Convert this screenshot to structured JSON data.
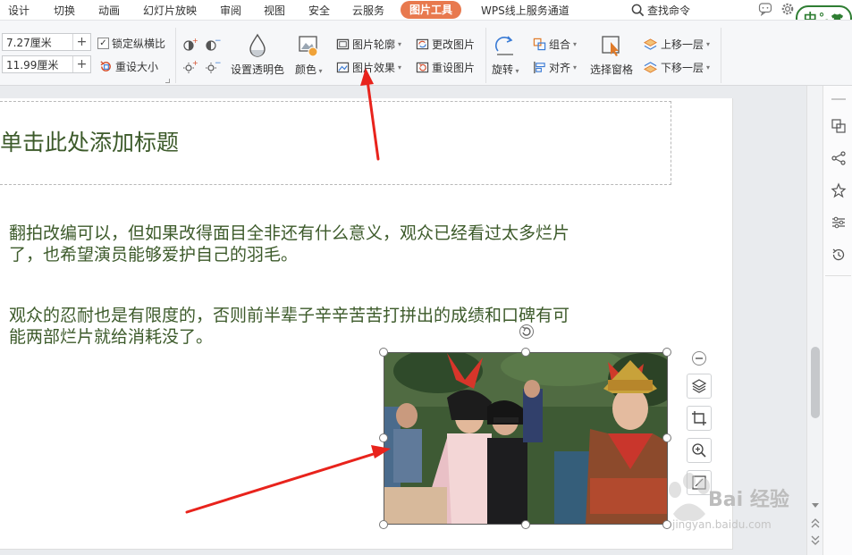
{
  "menu": {
    "tabs": [
      "设计",
      "切换",
      "动画",
      "幻灯片放映",
      "审阅",
      "视图",
      "安全",
      "云服务",
      "图片工具",
      "WPS线上服务通道"
    ],
    "active_tab": "图片工具",
    "search_label": "查找命令"
  },
  "ime": {
    "label": "中",
    "symbols": "°,"
  },
  "ribbon": {
    "width_value": "7.27厘米",
    "height_value": "11.99厘米",
    "lock_ratio_label": "锁定纵横比",
    "lock_ratio_checked": true,
    "reset_size_label": "重设大小",
    "set_transparent_label": "设置透明色",
    "color_label": "颜色",
    "picture_outline_label": "图片轮廓",
    "picture_effect_label": "图片效果",
    "change_picture_label": "更改图片",
    "reset_picture_label": "重设图片",
    "rotate_label": "旋转",
    "group_label": "组合",
    "align_label": "对齐",
    "selection_pane_label": "选择窗格",
    "bring_forward_label": "上移一层",
    "send_backward_label": "下移一层"
  },
  "slide": {
    "title_placeholder": "单击此处添加标题",
    "para1_line1": "翻拍改编可以，但如果改得面目全非还有什么意义，观众已经看过太多烂片",
    "para1_line2": "了，也希望演员能够爱护自己的羽毛。",
    "para2_line1": "观众的忍耐也是有限度的，否则前半辈子辛辛苦苦打拼出的成绩和口碑有可",
    "para2_line2": "能两部烂片就给消耗没了。"
  },
  "watermark": {
    "brand": "Bai 经验",
    "url": "jingyan.baidu.com"
  },
  "colors": {
    "active_tab": "#e8794e",
    "body_text": "#3c5a2a",
    "arrow": "#e8231c",
    "ime_border": "#2e7d32"
  }
}
